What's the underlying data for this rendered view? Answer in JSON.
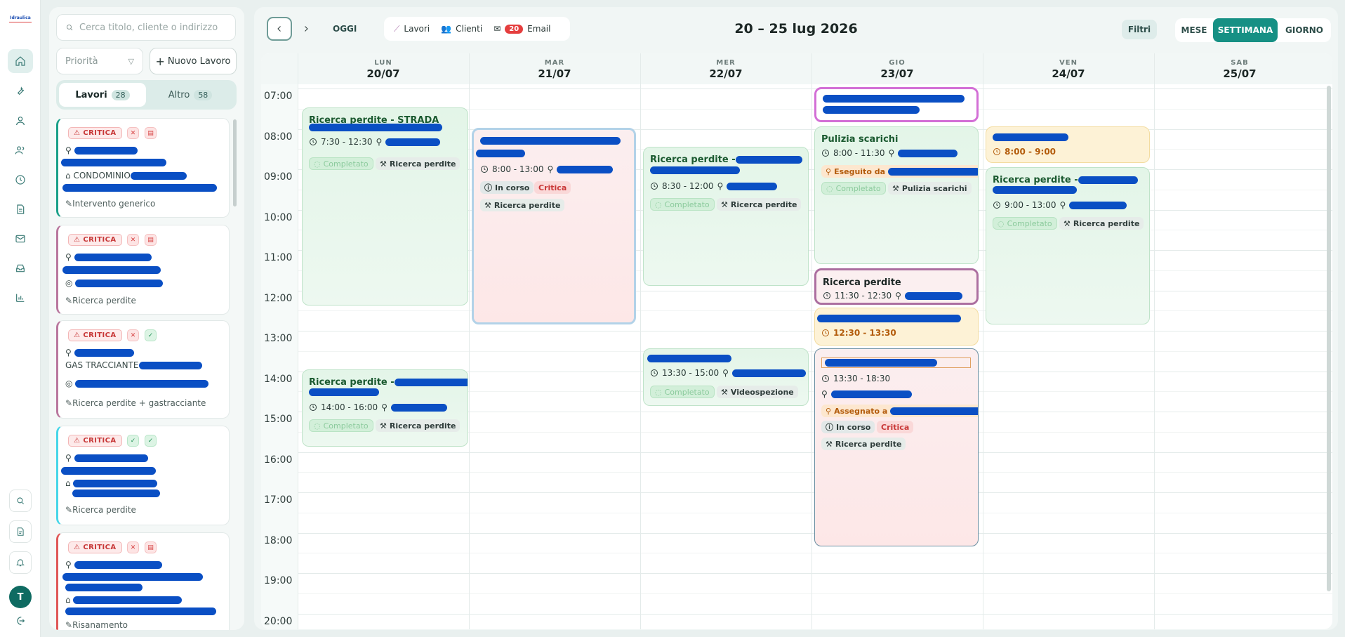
{
  "app": {
    "logo_text": "Idraulica"
  },
  "sidebar_panel": {
    "search_placeholder": "Cerca titolo, cliente o indirizzo",
    "priority_label": "Priorità",
    "new_job_label": "Nuovo Lavoro",
    "tabs": [
      {
        "label": "Lavori",
        "count": "28"
      },
      {
        "label": "Altro",
        "count": "58"
      }
    ],
    "cards": [
      {
        "badge": "CRITICA",
        "address_label": "CONDOMINIO",
        "category": "Intervento generico",
        "accent": "#1aa089"
      },
      {
        "badge": "CRITICA",
        "category": "Ricerca perdite",
        "accent": "#b9779e"
      },
      {
        "badge": "CRITICA",
        "address_label": "GAS TRACCIANTE",
        "category": "Ricerca perdite + gastracciante",
        "accent": "#b9779e"
      },
      {
        "badge": "CRITICA",
        "category": "Ricerca perdite",
        "accent": "#46d6e8"
      },
      {
        "badge": "CRITICA",
        "category": "Risanamento",
        "accent": "#e05757"
      }
    ]
  },
  "toolbar": {
    "today_label": "OGGI",
    "links": [
      {
        "label": "Lavori",
        "icon": "wrench-icon"
      },
      {
        "label": "Clienti",
        "icon": "users-icon"
      },
      {
        "label": "Email",
        "icon": "mail-icon",
        "count": "20"
      }
    ],
    "range_title": "20 – 25 lug 2026",
    "filters_label": "Filtri",
    "views": [
      "MESE",
      "SETTIMANA",
      "GIORNO"
    ],
    "active_view": "SETTIMANA"
  },
  "calendar": {
    "days": [
      {
        "name": "LUN",
        "date": "20/07"
      },
      {
        "name": "MAR",
        "date": "21/07"
      },
      {
        "name": "MER",
        "date": "22/07"
      },
      {
        "name": "GIO",
        "date": "23/07"
      },
      {
        "name": "VEN",
        "date": "24/07"
      },
      {
        "name": "SAB",
        "date": "25/07"
      }
    ],
    "hours": [
      "07:00",
      "08:00",
      "09:00",
      "10:00",
      "11:00",
      "12:00",
      "13:00",
      "14:00",
      "15:00",
      "16:00",
      "17:00",
      "18:00",
      "19:00",
      "20:00"
    ],
    "events": {
      "lun1": {
        "title": "Ricerca perdite - STRADA",
        "time": "7:30 - 12:30",
        "status": "Completato",
        "category": "Ricerca perdite"
      },
      "lun2": {
        "title": "Ricerca perdite -",
        "time": "14:00 - 16:00",
        "status": "Completato",
        "category": "Ricerca perdite"
      },
      "mar1": {
        "time": "8:00 - 13:00",
        "status": "In corso",
        "priority": "Critica",
        "category": "Ricerca perdite"
      },
      "mer1": {
        "title": "Ricerca perdite -",
        "time": "8:30 - 12:00",
        "status": "Completato",
        "category": "Ricerca perdite"
      },
      "mer2": {
        "time": "13:30 - 15:00",
        "status": "Completato",
        "category": "Videospezione"
      },
      "gio1": {
        "title": "Pulizia scarichi",
        "time": "8:00 - 11:30",
        "done_by": "Eseguito da",
        "status": "Completato",
        "category": "Pulizia scarichi"
      },
      "gio2": {
        "title": "Ricerca perdite",
        "time": "11:30 - 12:30"
      },
      "gio3": {
        "time": "12:30 - 13:30"
      },
      "gio4": {
        "time": "13:30 - 18:30",
        "assigned": "Assegnato a",
        "status": "In corso",
        "priority": "Critica",
        "category": "Ricerca perdite"
      },
      "ven1": {
        "time": "8:00 - 9:00"
      },
      "ven2": {
        "title": "Ricerca perdite -",
        "time": "9:00 - 13:00",
        "status": "Completato",
        "category": "Ricerca perdite"
      }
    }
  },
  "colors": {
    "accent": "#169084",
    "critical": "#c93838",
    "redaction": "#0a4fc4"
  }
}
